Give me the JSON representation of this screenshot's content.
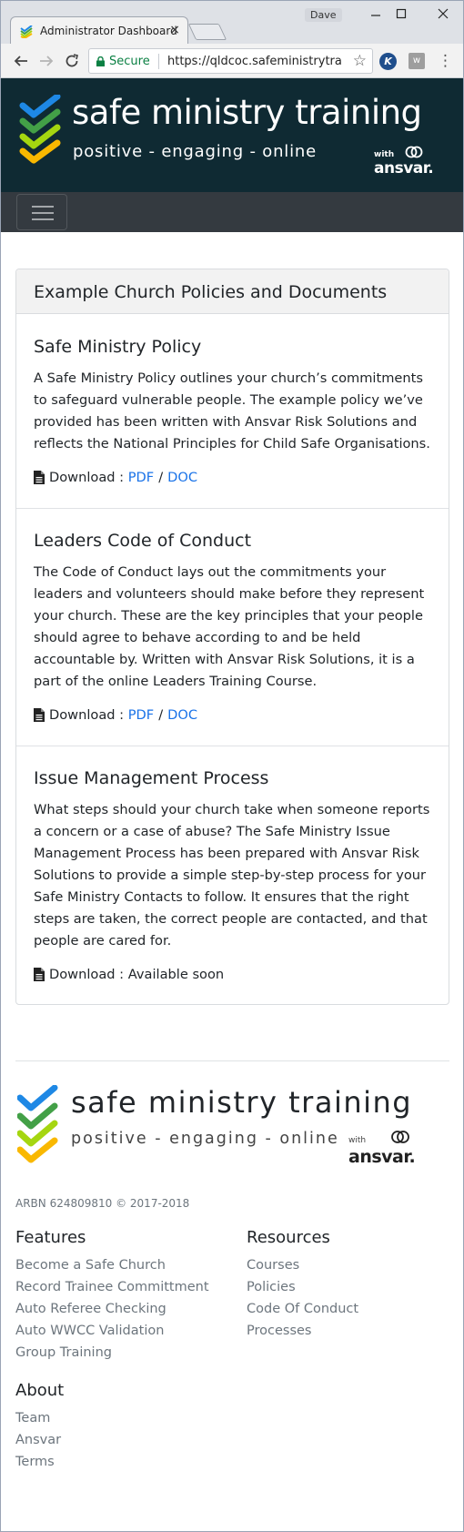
{
  "browser": {
    "tab_title": "Administrator Dashboard",
    "tab_close": "×",
    "profile_name": "Dave",
    "secure_label": "Secure",
    "url": "https://qldcoc.safeministrytrai...",
    "extension_k": "K",
    "extension_w": "w"
  },
  "header": {
    "logo_title": "safe ministry training",
    "logo_tagline": "positive - engaging - online",
    "partner_with": "with",
    "partner_name": "ansvar."
  },
  "card": {
    "title": "Example Church Policies and Documents",
    "download_label": "Download :",
    "policies": [
      {
        "title": "Safe Ministry Policy",
        "description": "A Safe Ministry Policy outlines your church’s commitments to safeguard vulnerable people. The example policy we’ve provided has been written with Ansvar Risk Solutions and reflects the National Principles for Child Safe Organisations.",
        "pdf": "PDF",
        "separator": "/",
        "doc": "DOC"
      },
      {
        "title": "Leaders Code of Conduct",
        "description": "The Code of Conduct lays out the commitments your leaders and volunteers should make before they represent your church. These are the key principles that your people should agree to behave according to and be held accountable by. Written with Ansvar Risk Solutions, it is a part of the online Leaders Training Course.",
        "pdf": "PDF",
        "separator": "/",
        "doc": "DOC"
      },
      {
        "title": "Issue Management Process",
        "description": "What steps should your church take when someone reports a concern or a case of abuse? The Safe Ministry Issue Management Process has been prepared with Ansvar Risk Solutions to provide a simple step-by-step process for your Safe Ministry Contacts to follow. It ensures that the right steps are taken, the correct people are contacted, and that people are cared for.",
        "availability": "Available soon"
      }
    ]
  },
  "footer": {
    "logo_title": "safe ministry training",
    "logo_tagline": "positive - engaging - online",
    "partner_with": "with",
    "partner_name": "ansvar.",
    "copyright": "ARBN 624809810 © 2017-2018",
    "features": {
      "heading": "Features",
      "links": [
        "Become a Safe Church",
        "Record Trainee Committment",
        "Auto Referee Checking",
        "Auto WWCC Validation",
        "Group Training"
      ]
    },
    "resources": {
      "heading": "Resources",
      "links": [
        "Courses",
        "Policies",
        "Code Of Conduct",
        "Processes"
      ]
    },
    "about": {
      "heading": "About",
      "links": [
        "Team",
        "Ansvar",
        "Terms"
      ]
    }
  },
  "colors": {
    "brand_dark": "#0f2a33",
    "navbar": "#343a40",
    "chevron_blue": "#1e88e5",
    "chevron_green": "#43a047",
    "chevron_lime": "#a5d610",
    "chevron_yellow": "#f9b800",
    "link_blue": "#1a73e8"
  }
}
